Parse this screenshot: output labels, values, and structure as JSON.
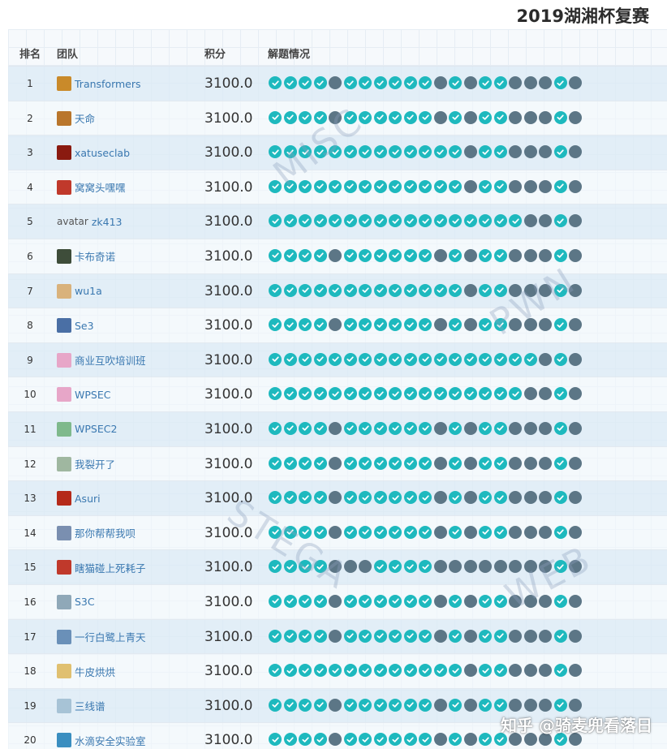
{
  "page_title": "2019湖湘杯复赛",
  "header": {
    "rank": "排名",
    "team": "团队",
    "score": "积分",
    "solves": "解题情况"
  },
  "watermarks": [
    "MISC",
    "PWN",
    "STEGA",
    "WEB"
  ],
  "credit": "知乎 @骑麦兜看落日",
  "colors": {
    "solved": "#1eb9be",
    "unsolved": "#5c7686",
    "team_link": "#3a78b0"
  },
  "rows": [
    {
      "rank": "1",
      "team": "Transformers",
      "score": "3100.0",
      "avatar": "#c98a2a",
      "solves": [
        1,
        1,
        1,
        1,
        0,
        1,
        1,
        1,
        1,
        1,
        1,
        0,
        1,
        0,
        1,
        1,
        0,
        0,
        0,
        1,
        0
      ]
    },
    {
      "rank": "2",
      "team": "天命",
      "score": "3100.0",
      "avatar": "#b9762c",
      "solves": [
        1,
        1,
        1,
        1,
        0,
        1,
        1,
        1,
        1,
        1,
        1,
        0,
        1,
        0,
        1,
        1,
        0,
        0,
        0,
        1,
        0
      ]
    },
    {
      "rank": "3",
      "team": "xatuseclab",
      "score": "3100.0",
      "avatar": "#8a1a10",
      "solves": [
        1,
        1,
        1,
        1,
        1,
        1,
        1,
        1,
        1,
        1,
        1,
        1,
        1,
        0,
        1,
        1,
        0,
        0,
        0,
        1,
        0
      ]
    },
    {
      "rank": "4",
      "team": "窝窝头嘿嘿",
      "score": "3100.0",
      "avatar": "#c0392b",
      "solves": [
        1,
        1,
        1,
        1,
        1,
        1,
        1,
        1,
        1,
        1,
        1,
        1,
        1,
        0,
        1,
        1,
        0,
        0,
        0,
        1,
        0
      ]
    },
    {
      "rank": "5",
      "team": "zk413",
      "score": "3100.0",
      "avatar": "#cccccc",
      "avatar_alt": "avatar",
      "solves": [
        1,
        1,
        1,
        1,
        1,
        1,
        1,
        1,
        1,
        1,
        1,
        1,
        1,
        1,
        1,
        1,
        1,
        0,
        0,
        1,
        0
      ]
    },
    {
      "rank": "6",
      "team": "卡布奇诺",
      "score": "3100.0",
      "avatar": "#3e4d3a",
      "solves": [
        1,
        1,
        1,
        1,
        0,
        1,
        1,
        1,
        1,
        1,
        1,
        0,
        1,
        0,
        1,
        1,
        0,
        0,
        0,
        1,
        0
      ]
    },
    {
      "rank": "7",
      "team": "wu1a",
      "score": "3100.0",
      "avatar": "#d9b27c",
      "solves": [
        1,
        1,
        1,
        1,
        1,
        1,
        1,
        1,
        1,
        1,
        1,
        1,
        1,
        0,
        1,
        1,
        0,
        0,
        0,
        1,
        0
      ]
    },
    {
      "rank": "8",
      "team": "Se3",
      "score": "3100.0",
      "avatar": "#4a6fa5",
      "solves": [
        1,
        1,
        1,
        1,
        0,
        1,
        1,
        1,
        1,
        1,
        1,
        0,
        1,
        0,
        1,
        1,
        0,
        0,
        0,
        1,
        0
      ]
    },
    {
      "rank": "9",
      "team": "商业互吹培训班",
      "score": "3100.0",
      "avatar": "#e7a6c8",
      "solves": [
        1,
        1,
        1,
        1,
        1,
        1,
        1,
        1,
        1,
        1,
        1,
        1,
        1,
        1,
        1,
        1,
        1,
        1,
        0,
        1,
        0
      ]
    },
    {
      "rank": "10",
      "team": "WPSEC",
      "score": "3100.0",
      "avatar": "#e7a6c8",
      "solves": [
        1,
        1,
        1,
        1,
        1,
        1,
        1,
        1,
        1,
        1,
        1,
        1,
        1,
        1,
        1,
        1,
        1,
        0,
        0,
        1,
        0
      ]
    },
    {
      "rank": "11",
      "team": "WPSEC2",
      "score": "3100.0",
      "avatar": "#7fb98c",
      "solves": [
        1,
        1,
        1,
        1,
        0,
        1,
        1,
        1,
        1,
        1,
        1,
        0,
        1,
        0,
        1,
        1,
        0,
        0,
        0,
        1,
        0
      ]
    },
    {
      "rank": "12",
      "team": "我裂开了",
      "score": "3100.0",
      "avatar": "#9fb7a0",
      "solves": [
        1,
        1,
        1,
        1,
        0,
        1,
        1,
        1,
        1,
        1,
        1,
        0,
        1,
        0,
        1,
        1,
        0,
        0,
        0,
        1,
        0
      ]
    },
    {
      "rank": "13",
      "team": "Asuri",
      "score": "3100.0",
      "avatar": "#b52a1a",
      "solves": [
        1,
        1,
        1,
        1,
        0,
        1,
        1,
        1,
        1,
        1,
        1,
        0,
        1,
        0,
        1,
        1,
        0,
        0,
        0,
        1,
        0
      ]
    },
    {
      "rank": "14",
      "team": "那你帮帮我呗",
      "score": "3100.0",
      "avatar": "#7a8fb0",
      "solves": [
        1,
        1,
        1,
        1,
        0,
        1,
        1,
        1,
        1,
        1,
        1,
        0,
        1,
        0,
        1,
        1,
        0,
        0,
        0,
        1,
        0
      ]
    },
    {
      "rank": "15",
      "team": "瞎猫碰上死耗子",
      "score": "3100.0",
      "avatar": "#c0392b",
      "solves": [
        1,
        1,
        1,
        1,
        0,
        0,
        0,
        1,
        1,
        1,
        1,
        0,
        0,
        0,
        0,
        0,
        0,
        0,
        0,
        1,
        0
      ]
    },
    {
      "rank": "16",
      "team": "S3C",
      "score": "3100.0",
      "avatar": "#8fa8b8",
      "solves": [
        1,
        1,
        1,
        1,
        0,
        1,
        1,
        1,
        1,
        1,
        1,
        0,
        1,
        0,
        1,
        1,
        0,
        0,
        0,
        1,
        0
      ]
    },
    {
      "rank": "17",
      "team": "一行白鹭上青天",
      "score": "3100.0",
      "avatar": "#6a90b8",
      "solves": [
        1,
        1,
        1,
        1,
        0,
        1,
        1,
        1,
        1,
        1,
        1,
        0,
        1,
        0,
        1,
        1,
        0,
        0,
        0,
        1,
        0
      ]
    },
    {
      "rank": "18",
      "team": "牛皮烘烘",
      "score": "3100.0",
      "avatar": "#e0c070",
      "solves": [
        1,
        1,
        1,
        1,
        1,
        1,
        1,
        1,
        1,
        1,
        1,
        1,
        1,
        0,
        1,
        1,
        0,
        0,
        0,
        1,
        0
      ]
    },
    {
      "rank": "19",
      "team": "三线谱",
      "score": "3100.0",
      "avatar": "#a7c3d6",
      "solves": [
        1,
        1,
        1,
        1,
        0,
        1,
        1,
        1,
        1,
        1,
        1,
        0,
        1,
        0,
        1,
        1,
        0,
        0,
        0,
        1,
        0
      ]
    },
    {
      "rank": "20",
      "team": "水滴安全实验室",
      "score": "3100.0",
      "avatar": "#3a8ec0",
      "solves": [
        1,
        1,
        1,
        1,
        0,
        1,
        1,
        1,
        1,
        1,
        1,
        0,
        1,
        0,
        1,
        1,
        0,
        0,
        0,
        1,
        0
      ]
    }
  ]
}
